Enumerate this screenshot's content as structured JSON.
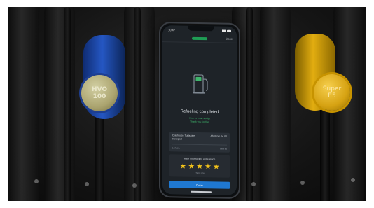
{
  "status_bar": {
    "time": "10:47"
  },
  "header": {
    "close_label": "Close"
  },
  "main": {
    "title": "Refueling completed",
    "subtitle_line1": "Here is your receipt",
    "subtitle_line2": "Thank you for fuel"
  },
  "receipt": {
    "station": "Clayhouse Turbulate",
    "station_line2": "transport",
    "amount": "Ahlstrom 14.00",
    "detail_left": "1 Macia",
    "detail_right": "sent 42"
  },
  "rating": {
    "label": "Rate your fueling experience",
    "stars": 5,
    "max_stars": 5,
    "hint": "Thank you"
  },
  "done_button": {
    "label": "Done"
  },
  "nozzles": {
    "left": {
      "line1": "HVO",
      "line2": "100",
      "color": "#2557c3"
    },
    "right": {
      "line1": "Super",
      "line2": "E5",
      "color": "#e2ad10"
    }
  },
  "colors": {
    "accent_blue": "#1f78d1",
    "brand_green": "#1f9d55",
    "star_yellow": "#f1c21b"
  }
}
